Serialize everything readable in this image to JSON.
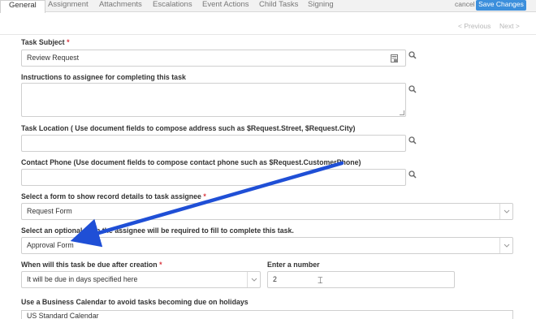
{
  "tabs": [
    {
      "label": "General",
      "active": true
    },
    {
      "label": "Assignment"
    },
    {
      "label": "Attachments"
    },
    {
      "label": "Escalations"
    },
    {
      "label": "Event Actions"
    },
    {
      "label": "Child Tasks"
    },
    {
      "label": "Signing"
    }
  ],
  "actions": {
    "cancel": "cancel",
    "save": "Save Changes"
  },
  "pager": {
    "previous": "< Previous",
    "next": "Next >"
  },
  "fields": {
    "subject": {
      "label": "Task Subject",
      "required": "*",
      "value": "Review Request"
    },
    "instructions": {
      "label": "Instructions to assignee for completing this task",
      "value": ""
    },
    "location": {
      "label": "Task Location ( Use document fields to compose address such as $Request.Street, $Request.City)",
      "value": ""
    },
    "phone": {
      "label": "Contact Phone (Use document fields to compose contact phone such as $Request.CustomerPhone)",
      "value": ""
    },
    "record_form": {
      "label": "Select a form to show record details to task assignee",
      "required": "*",
      "value": "Request Form"
    },
    "optional_form": {
      "label": "Select an optional form the assignee will be required to fill to complete this task.",
      "value": "Approval Form"
    },
    "due": {
      "label": "When will this task be due after creation",
      "required": "*",
      "value": "It will be due in days specified here"
    },
    "number": {
      "label": "Enter a number",
      "value": "2"
    },
    "calendar": {
      "label": "Use a Business Calendar to avoid tasks becoming due on holidays",
      "value": "US Standard Calendar"
    }
  },
  "colors": {
    "accent": "#3c8fdc",
    "arrow": "#1f4fd6",
    "required": "#d9363e"
  },
  "icons": [
    "search-icon",
    "document-icon",
    "chevron-down-icon"
  ]
}
